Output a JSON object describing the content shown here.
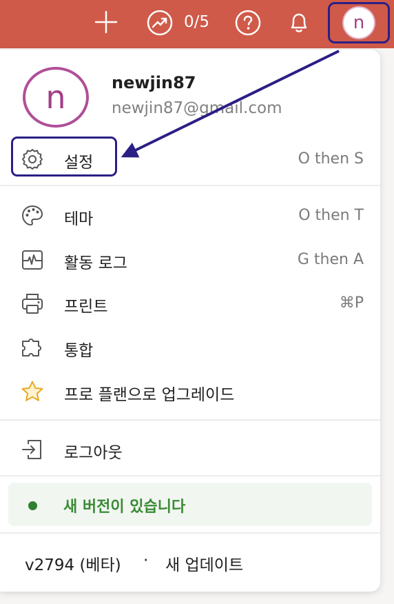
{
  "topbar": {
    "add_icon": "plus-icon",
    "karma_icon": "productivity-trend-icon",
    "karma_text": "0/5",
    "help_icon": "question-circle-icon",
    "notifications_icon": "bell-icon",
    "avatar_initial": "n"
  },
  "profile": {
    "avatar_initial": "n",
    "username": "newjin87",
    "email": "newjin87@gmail.com"
  },
  "menu": {
    "settings": {
      "label": "설정",
      "shortcut": "O then S",
      "icon": "gear-icon"
    },
    "items": [
      {
        "label": "테마",
        "shortcut": "O then T",
        "icon": "palette-icon"
      },
      {
        "label": "활동 로그",
        "shortcut": "G then A",
        "icon": "activity-icon"
      },
      {
        "label": "프린트",
        "shortcut": "⌘P",
        "icon": "printer-icon"
      },
      {
        "label": "통합",
        "shortcut": "",
        "icon": "puzzle-icon"
      },
      {
        "label": "프로 플랜으로 업그레이드",
        "shortcut": "",
        "icon": "star-icon"
      }
    ],
    "logout": {
      "label": "로그아웃",
      "icon": "logout-icon"
    }
  },
  "update": {
    "text": "새 버전이 있습니다"
  },
  "footer": {
    "version": "v2794 (베타)",
    "separator": "·",
    "new_update": "새 업데이트"
  },
  "colors": {
    "topbar": "#cf5a49",
    "highlight": "#2a1f85",
    "avatar": "#b04f98",
    "update_green": "#308030",
    "star_yellow": "#f0b429"
  }
}
